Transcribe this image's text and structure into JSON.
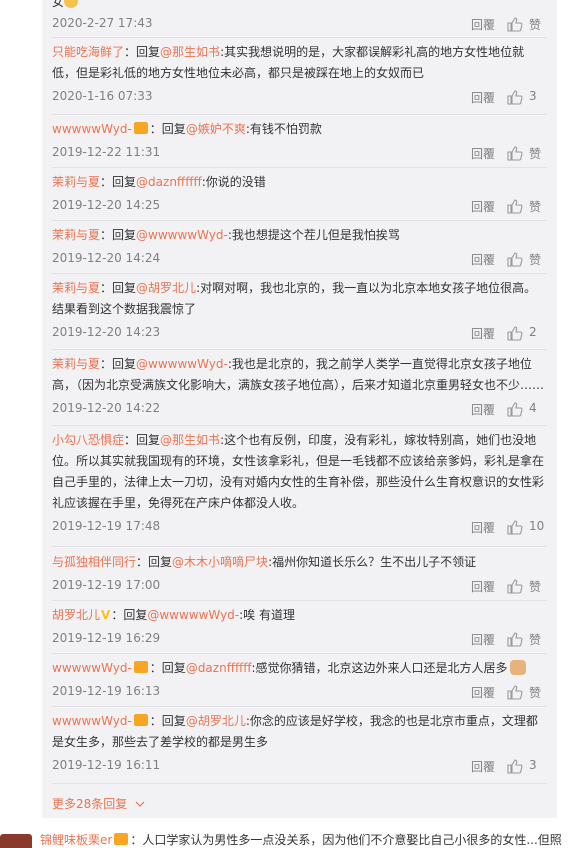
{
  "ui": {
    "reply_label": "回覆",
    "like_label": "赞",
    "more_label": "更多28条回复"
  },
  "top": {
    "tail": "女",
    "date": "2020-2-27 17:43",
    "likes": "赞"
  },
  "comments": [
    {
      "user": "只能吃海鲜了",
      "sep": "：",
      "prefix": "回复",
      "mention": "@那生如书",
      "text": ":其实我想说明的是，大家都误解彩礼高的地方女性地位就低，但是彩礼低的地方女性地位未必高，都只是被踩在地上的女奴而已",
      "date": "2020-1-16 07:33",
      "likes": "3"
    },
    {
      "user": "wwwwwWyd-",
      "sep": "：",
      "prefix": "回复",
      "mention": "@嫉妒不爽",
      "text": ":有钱不怕罚款",
      "date": "2019-12-22 11:31",
      "likes": "赞"
    },
    {
      "user": "茉莉与夏",
      "sep": "：",
      "prefix": "回复",
      "mention": "@daznffffff",
      "text": ":你说的没错",
      "date": "2019-12-20 14:25",
      "likes": "赞"
    },
    {
      "user": "茉莉与夏",
      "sep": "：",
      "prefix": "回复",
      "mention": "@wwwwwWyd-",
      "text": ":我也想提这个茬儿但是我怕挨骂",
      "date": "2019-12-20 14:24",
      "likes": "赞"
    },
    {
      "user": "茉莉与夏",
      "sep": "：",
      "prefix": "回复",
      "mention": "@胡罗北儿",
      "text": ":对啊对啊，我也北京的，我一直以为北京本地女孩子地位很高。结果看到这个数据我震惊了",
      "date": "2019-12-20 14:23",
      "likes": "2"
    },
    {
      "user": "茉莉与夏",
      "sep": "：",
      "prefix": "回复",
      "mention": "@wwwwwWyd-",
      "text": ":我也是北京的，我之前学人类学一直觉得北京女孩子地位高，（因为北京受满族文化影响大，满族女孩子地位高），后来才知道北京重男轻女也不少……",
      "date": "2019-12-20 14:22",
      "likes": "4"
    },
    {
      "user": "小勾八恐惧症",
      "sep": "：",
      "prefix": "回复",
      "mention": "@那生如书",
      "text": ":这个也有反例，印度，没有彩礼，嫁妆特别高，她们也没地位。所以其实就我国现有的环境，女性该拿彩礼，但是一毛钱都不应该给亲爹妈，彩礼是拿在自己手里的，法律上太一刀切，没有对婚内女性的生育补偿，那些没什么生育权意识的女性彩礼应该握在手里，免得死在产床户体都没人收。",
      "date": "2019-12-19 17:48",
      "likes": "10"
    },
    {
      "user": "与孤独相伴同行",
      "sep": "：",
      "prefix": "回复",
      "mention": "@木木小嘀嘀尸块",
      "text": ":福州你知道长乐么？生不出儿子不领证",
      "date": "2019-12-19 17:00",
      "likes": "赞"
    },
    {
      "user": "胡罗北儿",
      "sep": "：",
      "prefix": "回复",
      "mention": "@wwwwwWyd-",
      "text": ":唉 有道理",
      "date": "2019-12-19 16:29",
      "likes": "赞"
    },
    {
      "user": "wwwwwWyd-",
      "sep": "：",
      "prefix": "回复",
      "mention": "@daznffffff",
      "text": ":感觉你猜错，北京这边外来人口还是北方人居多",
      "date": "2019-12-19 16:13",
      "likes": "赞"
    },
    {
      "user": "wwwwwWyd-",
      "sep": "：",
      "prefix": "回复",
      "mention": "@胡罗北儿",
      "text": ":你念的应该是好学校，我念的也是北京市重点，文理都是女生多，那些去了差学校的都是男生多",
      "date": "2019-12-19 16:11",
      "likes": "3"
    }
  ],
  "bottom": {
    "user": "锦鲤味板栗er",
    "text": "：人口学家认为男性多一点没关系，因为他们不介意娶比自己小很多的女性...但照"
  }
}
